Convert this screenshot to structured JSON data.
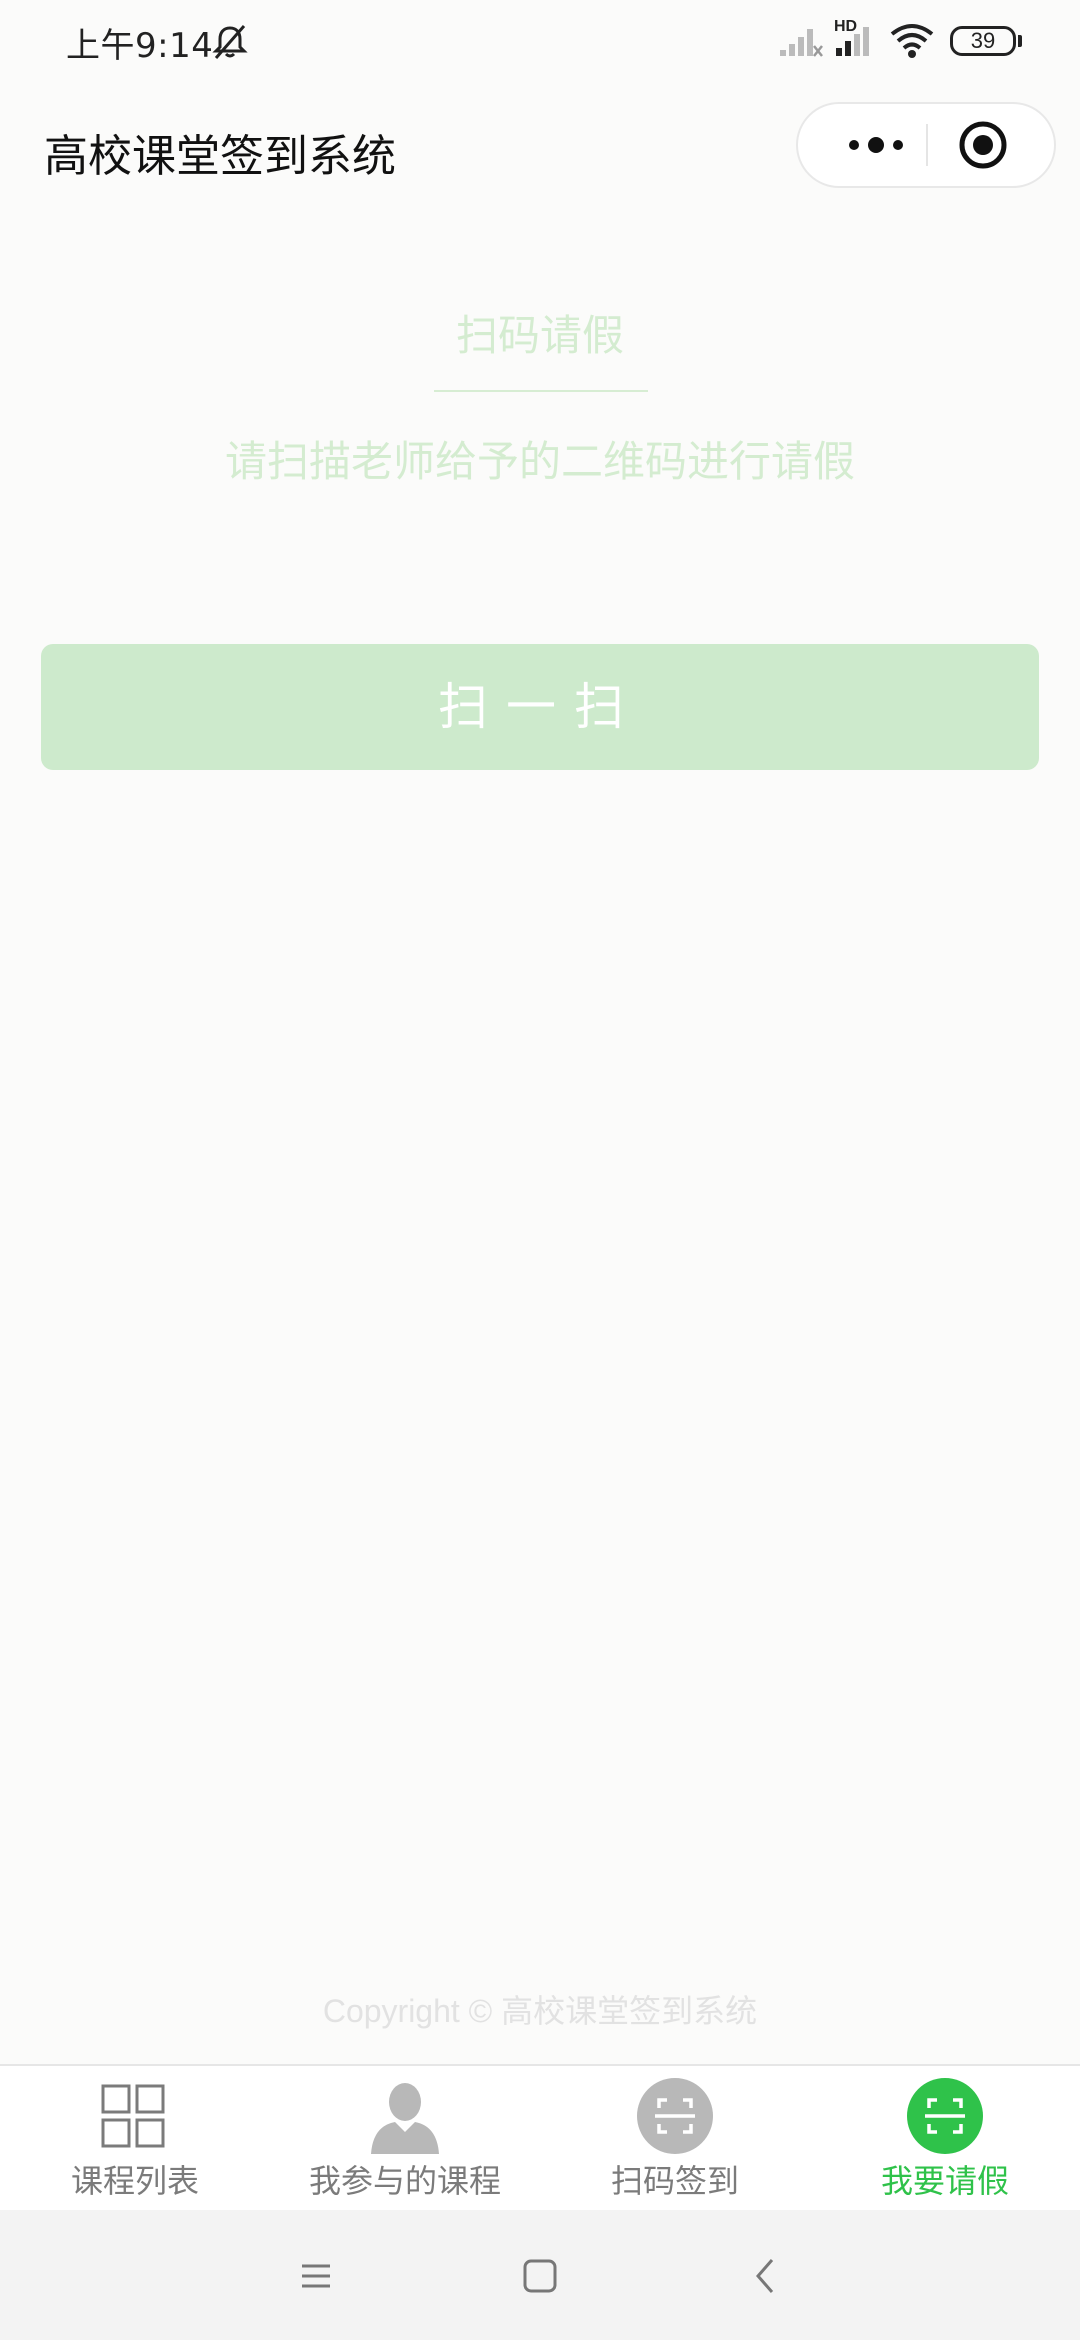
{
  "status_bar": {
    "time": "上午9:14",
    "battery": "39",
    "network_label": "HD",
    "icons": [
      "mute-icon",
      "signal-icon",
      "signal-hd-icon",
      "wifi-icon",
      "battery-icon"
    ]
  },
  "nav": {
    "title": "高校课堂签到系统",
    "more_icon": "more-dots-icon",
    "close_icon": "target-circle-icon"
  },
  "main": {
    "title": "扫码请假",
    "subtitle": "请扫描老师给予的二维码进行请假",
    "scan_button": "扫一扫",
    "copyright": "Copyright © 高校课堂签到系统"
  },
  "tabbar": {
    "tabs": [
      {
        "label": "课程列表",
        "icon": "grid-icon",
        "active": false
      },
      {
        "label": "我参与的课程",
        "icon": "user-avatar-icon",
        "active": false
      },
      {
        "label": "扫码签到",
        "icon": "scan-icon",
        "active": false
      },
      {
        "label": "我要请假",
        "icon": "scan-icon",
        "active": true
      }
    ],
    "active_color": "#2fc24a",
    "inactive_color": "#7b7b7b"
  },
  "system_nav": {
    "icons": [
      "menu-icon",
      "home-square-icon",
      "back-chevron-icon"
    ]
  },
  "colors": {
    "button_bg": "#cdeacc",
    "text_faint_green": "#d4ecd0",
    "page_bg": "#fbfbfa"
  }
}
